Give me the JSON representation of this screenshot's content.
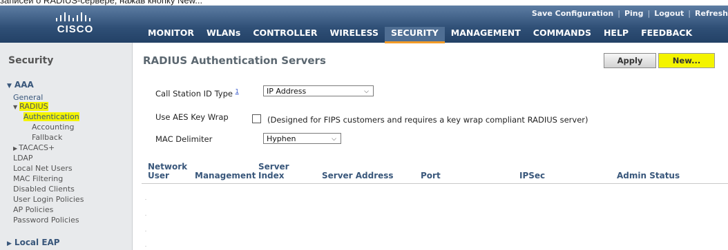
{
  "caption": "записей о RADIUS-сервере, нажав кнопку New...",
  "brand": {
    "name": "CISCO"
  },
  "top_links": [
    "Save Configuration",
    "Ping",
    "Logout",
    "Refresh"
  ],
  "nav_tabs": [
    "MONITOR",
    "WLANs",
    "CONTROLLER",
    "WIRELESS",
    "SECURITY",
    "MANAGEMENT",
    "COMMANDS",
    "HELP",
    "FEEDBACK"
  ],
  "active_tab": "SECURITY",
  "sidebar": {
    "title": "Security",
    "aaa": "AAA",
    "general": "General",
    "radius": "RADIUS",
    "authentication": "Authentication",
    "accounting": "Accounting",
    "fallback": "Fallback",
    "tacacs": "TACACS+",
    "ldap": "LDAP",
    "local_net_users": "Local Net Users",
    "mac_filtering": "MAC Filtering",
    "disabled_clients": "Disabled Clients",
    "user_login_policies": "User Login Policies",
    "ap_policies": "AP Policies",
    "password_policies": "Password Policies",
    "local_eap": "Local EAP"
  },
  "page": {
    "title": "RADIUS Authentication Servers",
    "apply_label": "Apply",
    "new_label": "New..."
  },
  "form": {
    "call_station_label": "Call Station ID Type",
    "call_station_sup": "1",
    "call_station_value": "IP Address",
    "aes_label": "Use AES Key Wrap",
    "aes_checked": false,
    "aes_note": "(Designed for FIPS customers and requires a key wrap compliant RADIUS server)",
    "mac_delim_label": "MAC Delimiter",
    "mac_delim_value": "Hyphen"
  },
  "table": {
    "col_network_user_1": "Network",
    "col_network_user_2": "User",
    "col_management": "Management",
    "col_server_index_1": "Server",
    "col_server_index_2": "Index",
    "col_server_address": "Server Address",
    "col_port": "Port",
    "col_ipsec": "IPSec",
    "col_admin_status": "Admin Status"
  },
  "colors": {
    "header": "#2f4f76",
    "active_underline": "#f39b27",
    "highlight": "#f4f400",
    "sidebar_bg": "#e8eaec"
  }
}
